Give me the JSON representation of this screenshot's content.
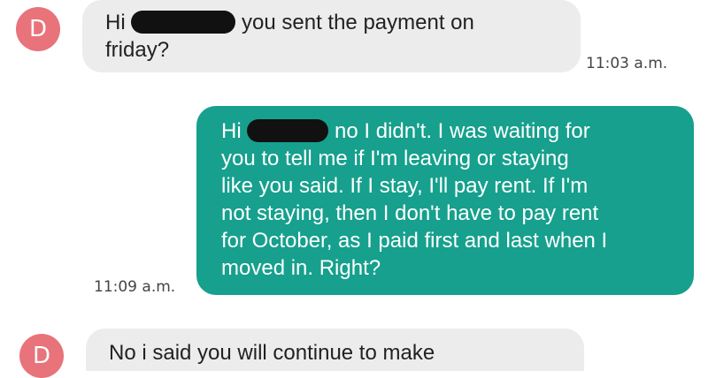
{
  "thread": {
    "messages": [
      {
        "sender_initial": "D",
        "greeting": "Hi",
        "text_after_redaction": "you sent the payment on",
        "text_line2": "friday?",
        "time": "11:03 a.m."
      },
      {
        "greeting": "Hi",
        "text_after_redaction": "no I didn't. I was waiting for",
        "lines": [
          "you to tell me if I'm leaving or staying",
          "like you said. If I stay, I'll pay rent. If I'm",
          "not staying, then I don't have to pay rent",
          "for October, as I paid first and last when I",
          "moved in. Right?"
        ],
        "time": "11:09 a.m."
      },
      {
        "sender_initial": "D",
        "text": "No i said you will continue to make"
      }
    ]
  },
  "colors": {
    "avatar": "#e8737b",
    "incoming_bubble": "#ececec",
    "outgoing_bubble": "#16a08d"
  }
}
